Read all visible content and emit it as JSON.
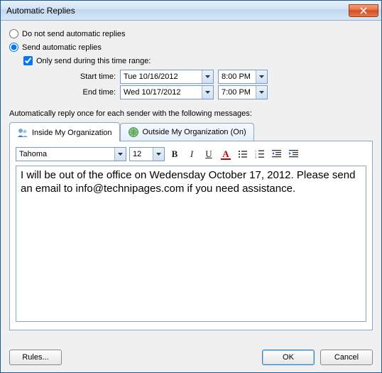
{
  "window": {
    "title": "Automatic Replies"
  },
  "options": {
    "do_not_send_label": "Do not send automatic replies",
    "send_label": "Send automatic replies",
    "only_send_range_label": "Only send during this time range:",
    "start_label": "Start time:",
    "end_label": "End time:",
    "start_date": "Tue 10/16/2012",
    "start_time": "8:00 PM",
    "end_date": "Wed 10/17/2012",
    "end_time": "7:00 PM",
    "selected": "send",
    "only_send_range_checked": true
  },
  "section_label": "Automatically reply once for each sender with the following messages:",
  "tabs": {
    "inside_label": "Inside My Organization",
    "outside_label": "Outside My Organization (On)",
    "active": "inside"
  },
  "editor": {
    "font_name": "Tahoma",
    "font_size": "12",
    "body": "I will be out of the office on Wedensday October 17, 2012. Please send an email to info@technipages.com if you need assistance."
  },
  "buttons": {
    "rules": "Rules...",
    "ok": "OK",
    "cancel": "Cancel"
  }
}
